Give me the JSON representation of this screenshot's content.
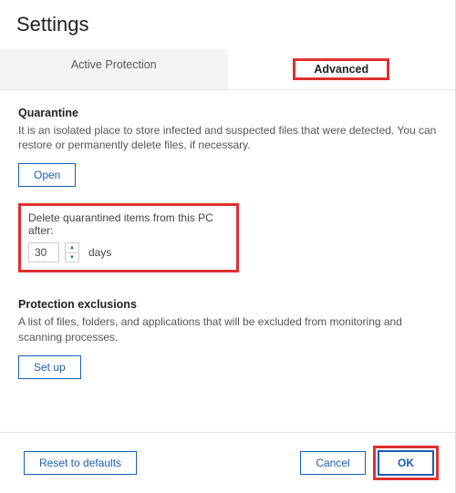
{
  "title": "Settings",
  "tabs": {
    "active_protection": "Active Protection",
    "advanced": "Advanced"
  },
  "quarantine": {
    "title": "Quarantine",
    "desc": "It is an isolated place to store infected and suspected files that were detected. You can restore or permanently delete files, if necessary.",
    "open_label": "Open",
    "delete_label": "Delete quarantined items from this PC after:",
    "delete_value": "30",
    "days_label": "days"
  },
  "exclusions": {
    "title": "Protection exclusions",
    "desc": "A list of files, folders, and applications that will be excluded from monitoring and scanning processes.",
    "setup_label": "Set up"
  },
  "footer": {
    "reset_label": "Reset to defaults",
    "cancel_label": "Cancel",
    "ok_label": "OK"
  }
}
